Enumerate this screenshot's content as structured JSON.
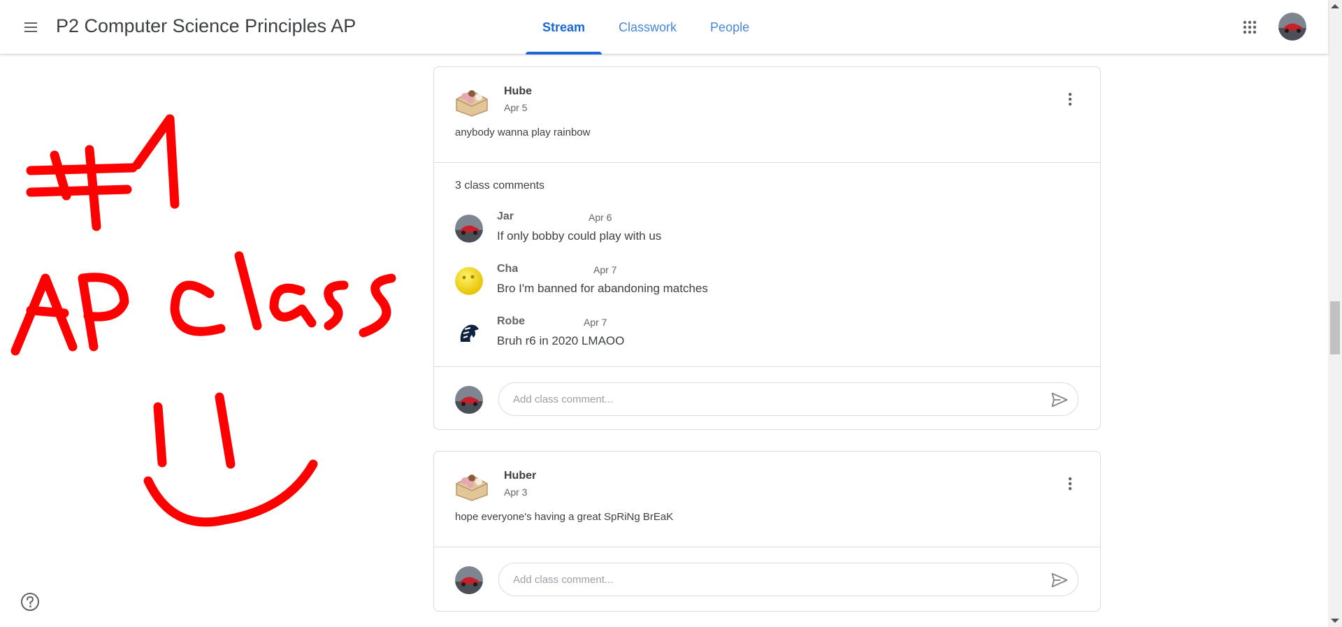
{
  "header": {
    "class_title": "P2 Computer Science Principles AP",
    "tabs": [
      {
        "label": "Stream",
        "active": true
      },
      {
        "label": "Classwork",
        "active": false
      },
      {
        "label": "People",
        "active": false
      }
    ],
    "icons": {
      "menu": "hamburger-menu-icon",
      "apps": "google-apps-grid-icon",
      "account": "account-avatar"
    }
  },
  "banner_drawing": {
    "lines": [
      "#1",
      "AP Class",
      ":)"
    ],
    "color": "#ff0000"
  },
  "posts": [
    {
      "author": "Hube",
      "date": "Apr 5",
      "text": "anybody wanna play rainbow",
      "comments_count_label": "3 class comments",
      "comments": [
        {
          "author": "Jar",
          "date": "Apr 6",
          "text": "If only bobby could play with us"
        },
        {
          "author": "Cha",
          "date": "Apr 7",
          "text": "Bro I'm banned for abandoning matches"
        },
        {
          "author": "Robe",
          "date": "Apr 7",
          "text": "Bruh r6 in 2020 LMAOO"
        }
      ],
      "add_comment_placeholder": "Add class comment..."
    },
    {
      "author": "Huber",
      "date": "Apr 3",
      "text": "hope everyone's having a great SpRiNg BrEaK",
      "add_comment_placeholder": "Add class comment..."
    }
  ],
  "colors": {
    "accent": "#1967d2",
    "text": "#3c4043",
    "muted": "#5f6368",
    "border": "#dadce0",
    "drawing_red": "#ff0000"
  }
}
